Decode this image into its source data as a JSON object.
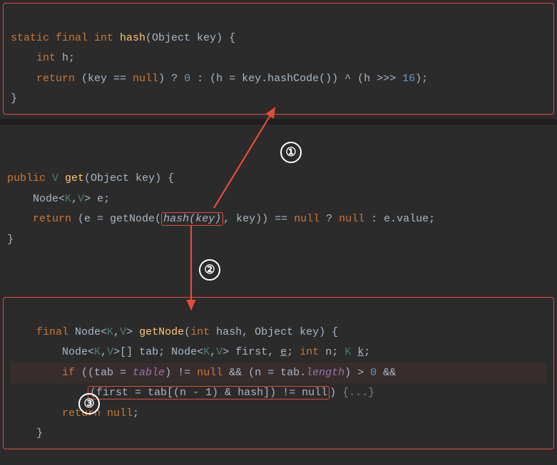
{
  "block1": {
    "l1_a": "static final int ",
    "l1_b": "hash",
    "l1_c": "(Object key) {",
    "l2_a": "    int ",
    "l2_b": "h;",
    "l3_a": "    return ",
    "l3_b": "(key == ",
    "l3_c": "null",
    "l3_d": ") ? ",
    "l3_e": "0",
    "l3_f": " : (h = key.hashCode()) ^ (h >>> ",
    "l3_g": "16",
    "l3_h": ");",
    "l4": "}"
  },
  "block2": {
    "l1_a": "public ",
    "l1_b": "V ",
    "l1_c": "get",
    "l1_d": "(Object key) {",
    "l2_a": "    Node<",
    "l2_b": "K",
    "l2_c": ",",
    "l2_d": "V",
    "l2_e": "> e;",
    "l3_a": "    return ",
    "l3_b": "(e = getNode(",
    "l3_box": "hash(key)",
    "l3_c": ", key)) == ",
    "l3_d": "null",
    "l3_e": " ? ",
    "l3_f": "null",
    "l3_g": " : e.value;",
    "l4": "}"
  },
  "block3": {
    "l1_a": "    final ",
    "l1_b": "Node<",
    "l1_c": "K",
    "l1_d": ",",
    "l1_e": "V",
    "l1_f": "> ",
    "l1_g": "getNode",
    "l1_h": "(",
    "l1_i": "int ",
    "l1_j": "hash, Object key) {",
    "l2_a": "        Node<",
    "l2_b": "K",
    "l2_c": ",",
    "l2_d": "V",
    "l2_e": ">[] tab; Node<",
    "l2_f": "K",
    "l2_g": ",",
    "l2_h": "V",
    "l2_i": "> first, ",
    "l2_j": "e",
    "l2_k": "; ",
    "l2_l": "int ",
    "l2_m": "n; ",
    "l2_n": "K ",
    "l2_o": "k",
    "l2_p": ";",
    "l3_a": "        if ",
    "l3_b": "((tab = ",
    "l3_c": "table",
    "l3_d": ") != ",
    "l3_e": "null",
    "l3_f": " && (n = tab.",
    "l3_g": "length",
    "l3_h": ") > ",
    "l3_i": "0",
    "l3_j": " &&",
    "l4_a": "            ",
    "l4_box": "(first = tab[(n - 1) & hash]) != null",
    "l4_b": ") ",
    "l4_fold": "{...}",
    "l5_a": "        return null",
    "l5_b": ";",
    "l6": "    }"
  },
  "labels": {
    "c1": "①",
    "c2": "②",
    "c3": "③"
  }
}
